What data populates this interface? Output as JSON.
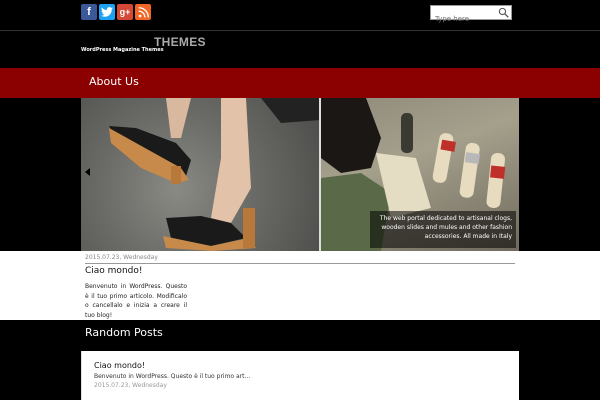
{
  "social": {
    "facebook_label": "f",
    "twitter_label": "t",
    "googleplus_label": "g+",
    "rss_label": "rss"
  },
  "search": {
    "placeholder": "Type here"
  },
  "brand": {
    "title": "THEMES",
    "subtitle": "WordPress Magazine Themes"
  },
  "nav": {
    "about_label": "About Us"
  },
  "slider": {
    "caption": "The web portal dedicated to artisanal clogs, wooden slides and mules and other fashion accessories. All made in Italy"
  },
  "post": {
    "date": "2015.07.23, Wednesday",
    "title": "Ciao mondo!",
    "excerpt": "Benvenuto in WordPress. Questo è il tuo primo articolo. Modificalo o cancellalo e inizia a creare il tuo blog!"
  },
  "random_posts": {
    "heading": "Random Posts",
    "items": [
      {
        "title": "Ciao mondo!",
        "excerpt": "Benvenuto in WordPress. Questo è il tuo primo art...",
        "date": "2015.07.23, Wednesday"
      }
    ]
  },
  "colors": {
    "nav_red": "#8b0000",
    "background": "#000000"
  }
}
